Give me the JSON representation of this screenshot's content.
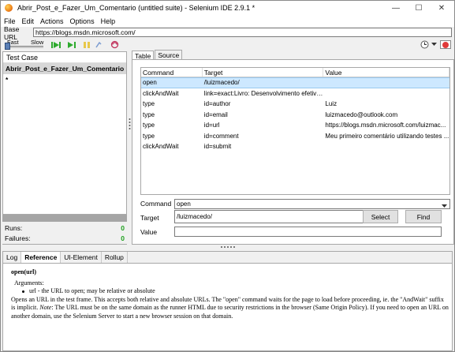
{
  "window": {
    "title": "Abrir_Post_e_Fazer_Um_Comentario (untitled suite) - Selenium IDE 2.9.1 *",
    "minimize_glyph": "—",
    "maximize_glyph": "☐",
    "close_glyph": "✕"
  },
  "menu": [
    "File",
    "Edit",
    "Actions",
    "Options",
    "Help"
  ],
  "base_url": {
    "label": "Base URL",
    "value": "https://blogs.msdn.microsoft.com/"
  },
  "toolbar": {
    "fast_label": "Fast",
    "slow_label": "Slow"
  },
  "test_case": {
    "header": "Test Case",
    "items": [
      "Abrir_Post_e_Fazer_Um_Comentario *"
    ]
  },
  "stats": {
    "runs_label": "Runs:",
    "runs_value": "0",
    "failures_label": "Failures:",
    "failures_value": "0"
  },
  "editor_tabs": [
    "Table",
    "Source"
  ],
  "table": {
    "columns": [
      "Command",
      "Target",
      "Value"
    ],
    "rows": [
      {
        "command": "open",
        "target": "/luizmacedo/",
        "value": ""
      },
      {
        "command": "clickAndWait",
        "target": "link=exact:Livro: Desenvolvimento efetivo n...",
        "value": ""
      },
      {
        "command": "type",
        "target": "id=author",
        "value": "Luiz"
      },
      {
        "command": "type",
        "target": "id=email",
        "value": "luizmacedo@outlook.com"
      },
      {
        "command": "type",
        "target": "id=url",
        "value": "https://blogs.msdn.microsoft.com/luizmac..."
      },
      {
        "command": "type",
        "target": "id=comment",
        "value": "Meu primeiro comentário utilizando testes ..."
      },
      {
        "command": "clickAndWait",
        "target": "id=submit",
        "value": ""
      }
    ]
  },
  "form": {
    "command_label": "Command",
    "command_value": "open",
    "target_label": "Target",
    "target_value": "/luizmacedo/",
    "value_label": "Value",
    "value_value": "",
    "select_button": "Select",
    "find_button": "Find"
  },
  "bottom_tabs": [
    "Log",
    "Reference",
    "UI-Element",
    "Rollup"
  ],
  "reference": {
    "signature": "open(url)",
    "arguments_label": "Arguments:",
    "argument": "url - the URL to open; may be relative or absolute",
    "description_1": "Opens an URL in the test frame. This accepts both relative and absolute URLs. The \"open\" command waits for the page to load before proceeding, ie. the \"AndWait\" suffix is implicit.",
    "note_label": "Note",
    "description_2": ": The URL must be on the same domain as the runner HTML due to security restrictions in the browser (Same Origin Policy). If you need to open an URL on another domain, use the Selenium Server to start a new browser session on that domain."
  },
  "colors": {
    "selected_row": "#cde8ff",
    "success_green": "#1da01d",
    "play_green": "#2eaa2e"
  },
  "icons": [
    "firefox-icon",
    "play-suite-icon",
    "play-test-icon",
    "pause-icon",
    "step-icon",
    "rollup-icon",
    "schedule-clock-icon",
    "record-icon"
  ]
}
